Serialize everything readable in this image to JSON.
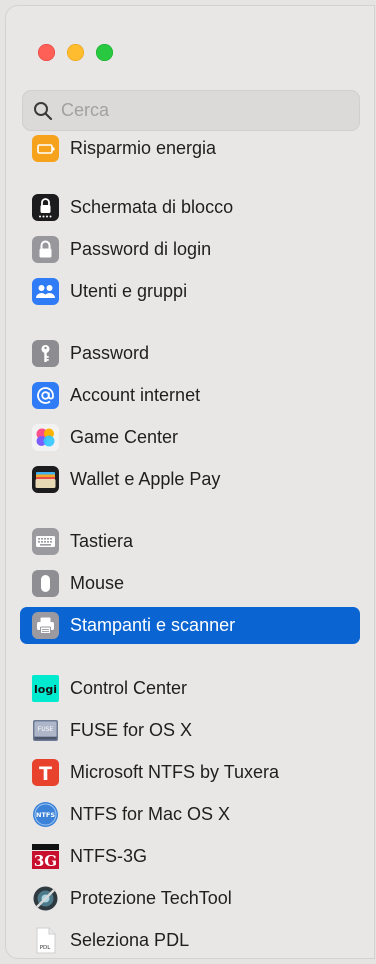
{
  "window": {
    "controls": [
      "close",
      "minimize",
      "zoom"
    ]
  },
  "search": {
    "placeholder": "Cerca"
  },
  "sidebar": {
    "items": [
      {
        "label": "Risparmio energia",
        "icon": "battery-icon",
        "color": "#f6a21c"
      },
      {
        "label": "Schermata di blocco",
        "icon": "lock-screen-icon",
        "color": "#1c1c1e"
      },
      {
        "label": "Password di login",
        "icon": "padlock-icon",
        "color": "#8e8e93"
      },
      {
        "label": "Utenti e gruppi",
        "icon": "users-icon",
        "color": "#2f7cf6"
      },
      {
        "label": "Password",
        "icon": "key-icon",
        "color": "#8e8e93"
      },
      {
        "label": "Account internet",
        "icon": "at-sign-icon",
        "color": "#2f7cf6"
      },
      {
        "label": "Game Center",
        "icon": "game-center-icon",
        "color": "#e8e8e8"
      },
      {
        "label": "Wallet e Apple Pay",
        "icon": "wallet-icon",
        "color": "#1c1c1e"
      },
      {
        "label": "Tastiera",
        "icon": "keyboard-icon",
        "color": "#8e8e93"
      },
      {
        "label": "Mouse",
        "icon": "mouse-icon",
        "color": "#8e8e93"
      },
      {
        "label": "Stampanti e scanner",
        "icon": "printer-icon",
        "color": "#8e8e93",
        "selected": true
      },
      {
        "label": "Control Center",
        "icon": "logi-icon",
        "color": "#00ead0",
        "icon_text": "logi"
      },
      {
        "label": "FUSE for OS X",
        "icon": "fuse-drive-icon",
        "color": "#9aa3b5",
        "icon_text": "FUSE"
      },
      {
        "label": "Microsoft NTFS by Tuxera",
        "icon": "tuxera-icon",
        "color": "#e8412c",
        "icon_text": "T"
      },
      {
        "label": "NTFS for Mac OS X",
        "icon": "ntfs-mac-icon",
        "color": "#3b82d8",
        "icon_text": "NTFS"
      },
      {
        "label": "NTFS-3G",
        "icon": "ntfs-3g-icon",
        "color": "#c8102e",
        "icon_text": "3G"
      },
      {
        "label": "Protezione TechTool",
        "icon": "techtool-icon",
        "color": "#3c4a52"
      },
      {
        "label": "Seleziona PDL",
        "icon": "pdl-document-icon",
        "color": "#ffffff",
        "icon_text": "PDL"
      }
    ]
  },
  "colors": {
    "selection": "#0a64d2",
    "sidebar_bg": "#e9e7e6",
    "search_bg": "#dcdad9"
  }
}
